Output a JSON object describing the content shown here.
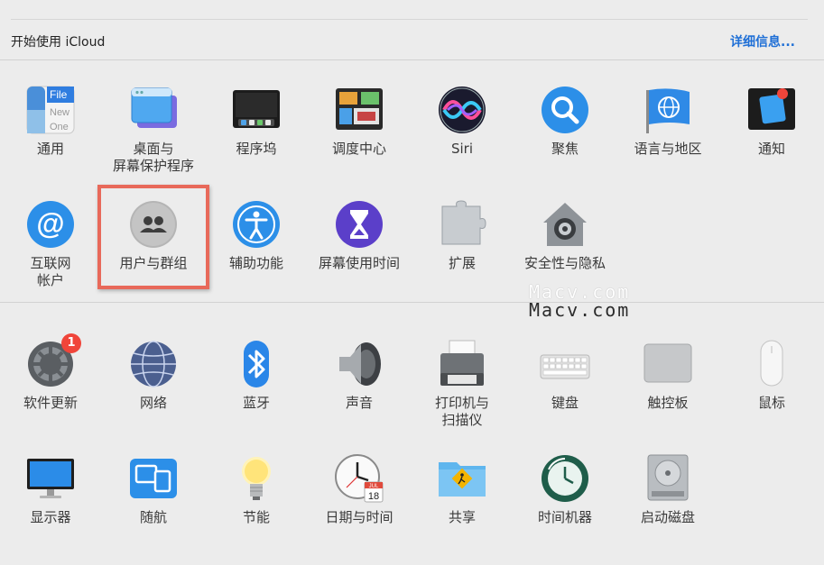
{
  "banner": {
    "title": "开始使用 iCloud",
    "link": "详细信息..."
  },
  "row1": [
    {
      "label": "通用",
      "icon": "general-icon",
      "file_text": "File",
      "new_text": "New",
      "one_text": "One"
    },
    {
      "label": "桌面与",
      "label2": "屏幕保护程序",
      "icon": "desktop-icon"
    },
    {
      "label": "程序坞",
      "icon": "dock-icon"
    },
    {
      "label": "调度中心",
      "icon": "mission-control-icon"
    },
    {
      "label": "Siri",
      "icon": "siri-icon"
    },
    {
      "label": "聚焦",
      "icon": "spotlight-icon"
    },
    {
      "label": "语言与地区",
      "icon": "globe-flag-icon"
    },
    {
      "label": "通知",
      "icon": "notifications-icon"
    }
  ],
  "row2": [
    {
      "label": "互联网",
      "label2": "帐户",
      "icon": "at-icon"
    },
    {
      "label": "用户与群组",
      "icon": "users-icon"
    },
    {
      "label": "辅助功能",
      "icon": "accessibility-icon"
    },
    {
      "label": "屏幕使用时间",
      "icon": "hourglass-icon"
    },
    {
      "label": "扩展",
      "icon": "puzzle-icon"
    },
    {
      "label": "安全性与隐私",
      "icon": "house-lock-icon"
    }
  ],
  "row3": [
    {
      "label": "软件更新",
      "icon": "gear-icon",
      "badge": "1"
    },
    {
      "label": "网络",
      "icon": "network-globe-icon"
    },
    {
      "label": "蓝牙",
      "icon": "bluetooth-icon"
    },
    {
      "label": "声音",
      "icon": "speaker-icon"
    },
    {
      "label": "打印机与",
      "label2": "扫描仪",
      "icon": "printer-icon"
    },
    {
      "label": "键盘",
      "icon": "keyboard-icon"
    },
    {
      "label": "触控板",
      "icon": "trackpad-icon"
    },
    {
      "label": "鼠标",
      "icon": "mouse-icon"
    }
  ],
  "row4": [
    {
      "label": "显示器",
      "icon": "display-icon"
    },
    {
      "label": "随航",
      "icon": "sidecar-icon"
    },
    {
      "label": "节能",
      "icon": "lightbulb-icon"
    },
    {
      "label": "日期与时间",
      "icon": "clock-calendar-icon",
      "cal_month": "JUL",
      "cal_day": "18"
    },
    {
      "label": "共享",
      "icon": "sharing-folder-icon"
    },
    {
      "label": "时间机器",
      "icon": "time-machine-icon"
    },
    {
      "label": "启动磁盘",
      "icon": "disk-icon"
    }
  ],
  "watermark": {
    "line1": "Macv.com",
    "line2": "Macv.com"
  },
  "colors": {
    "accent": "#1f6fd6",
    "highlight": "#e8695a",
    "badge": "#f0453a"
  }
}
